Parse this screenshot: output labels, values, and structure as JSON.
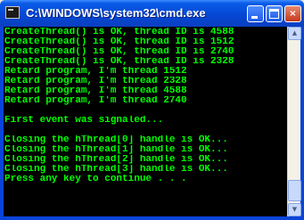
{
  "window": {
    "title": "C:\\WINDOWS\\system32\\cmd.exe",
    "icon": "console-icon",
    "buttons": {
      "minimize": "minimize-icon",
      "maximize": "maximize-icon",
      "close": "×"
    }
  },
  "console": {
    "text_color": "#00ff00",
    "background": "#000000",
    "lines": [
      "CreateThread() is OK, thread ID is 4588",
      "CreateThread() is OK, thread ID is 1512",
      "CreateThread() is OK, thread ID is 2740",
      "CreateThread() is OK, thread ID is 2328",
      "Retard program, I'm thread 1512",
      "Retard program, I'm thread 2328",
      "Retard program, I'm thread 4588",
      "Retard program, I'm thread 2740",
      "",
      "First event was signaled...",
      "",
      "Closing the hThread[0] handle is OK...",
      "Closing the hThread[1] handle is OK...",
      "Closing the hThread[2] handle is OK...",
      "Closing the hThread[3] handle is OK...",
      "Press any key to continue . . ."
    ]
  },
  "scrollbar": {
    "up": "▲",
    "down": "▼"
  }
}
